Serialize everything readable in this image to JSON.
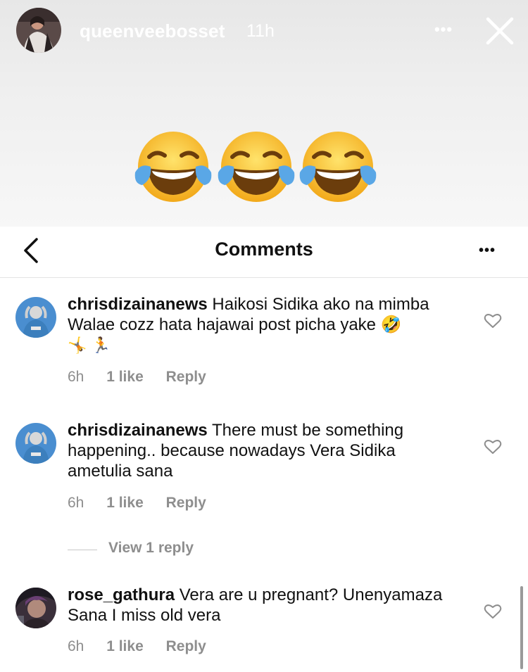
{
  "story": {
    "username": "queenveebosset",
    "time": "11h",
    "more_label": "•••",
    "emoji": [
      "😂",
      "😂",
      "😂"
    ]
  },
  "comments_panel": {
    "title": "Comments",
    "more_label": "•••"
  },
  "comments": [
    {
      "username": "chrisdizainanews",
      "text": "Haikosi Sidika ako na mimba Walae cozz hata hajawai post picha yake 🤣",
      "extra": "🤸 🏃",
      "time": "6h",
      "likes": "1 like",
      "reply": "Reply"
    },
    {
      "username": "chrisdizainanews",
      "text": "There must be something happening.. because nowadays Vera Sidika ametulia sana",
      "time": "6h",
      "likes": "1 like",
      "reply": "Reply",
      "view_replies": "View 1 reply"
    },
    {
      "username": "rose_gathura",
      "text": "Vera are u pregnant? Unenyamaza Sana I miss old vera",
      "time": "6h",
      "likes": "1 like",
      "reply": "Reply"
    }
  ],
  "colors": {
    "meta_gray": "#8e8e8e",
    "text": "#111111",
    "story_bg": "#eeeeee"
  },
  "icons": [
    "story-avatar",
    "more-icon",
    "close-icon",
    "back-icon",
    "heart-icon",
    "avatar"
  ]
}
